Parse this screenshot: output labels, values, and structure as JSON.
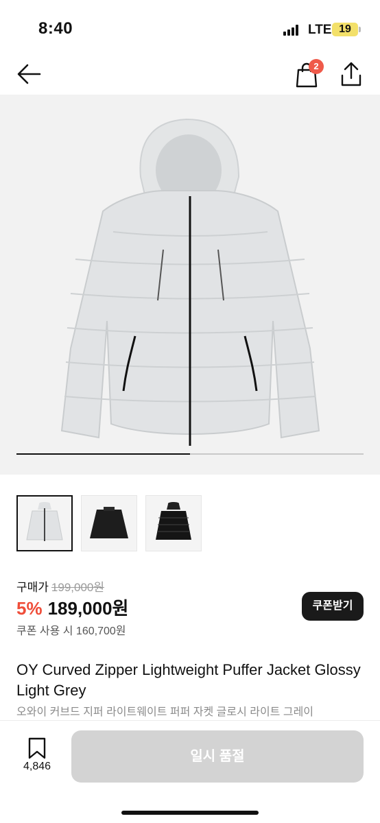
{
  "status_bar": {
    "time": "8:40",
    "network": "LTE",
    "battery": "19"
  },
  "nav": {
    "back_icon": "back-arrow-icon",
    "cart_icon": "shopping-bag-icon",
    "cart_badge": "2",
    "share_icon": "share-icon"
  },
  "gallery": {
    "progress": 0.5,
    "thumbnails": [
      {
        "color": "light-grey",
        "selected": true
      },
      {
        "color": "black",
        "selected": false
      },
      {
        "color": "black-glossy",
        "selected": false
      }
    ]
  },
  "price": {
    "label": "구매가",
    "original": "199,000원",
    "discount": "5%",
    "sale": "189,000원",
    "coupon_price": "쿠폰 사용 시 160,700원",
    "coupon_button": "쿠폰받기"
  },
  "product": {
    "title_en": "OY Curved Zipper Lightweight Puffer Jacket Glossy Light Grey",
    "title_ko": "오와이 커브드 지퍼 라이트웨이트 퍼퍼 자켓 글로시 라이트 그레이"
  },
  "bottom_bar": {
    "wish_icon": "bookmark-icon",
    "wish_count": "4,846",
    "soldout_label": "일시 품절"
  },
  "colors": {
    "accent_red": "#ef4e3a",
    "badge_red": "#ef5a4a",
    "disabled_button": "#d3d3d3",
    "dark_button": "#1a1a1a"
  }
}
